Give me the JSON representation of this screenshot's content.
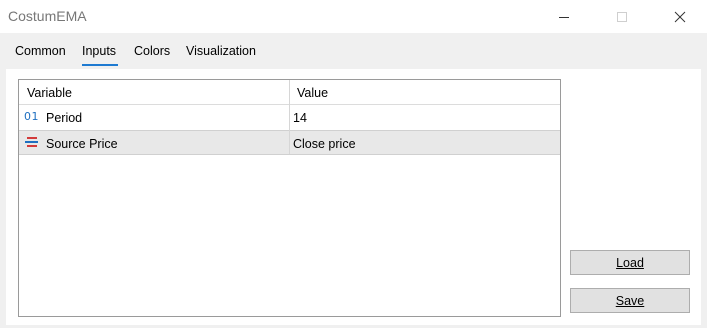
{
  "window": {
    "title": "CostumEMA",
    "controls": {
      "minimize_icon": "minimize-icon",
      "maximize_icon": "maximize-icon",
      "close_icon": "close-icon"
    }
  },
  "tabs": [
    {
      "label": "Common",
      "active": false
    },
    {
      "label": "Inputs",
      "active": true
    },
    {
      "label": "Colors",
      "active": false
    },
    {
      "label": "Visualization",
      "active": false
    }
  ],
  "accent_color": "#1e7ad1",
  "grid": {
    "columns": [
      "Variable",
      "Value"
    ],
    "rows": [
      {
        "icon": "integer-icon",
        "icon_text": "01",
        "variable": "Period",
        "value": "14",
        "selected": false
      },
      {
        "icon": "enum-list-icon",
        "variable": "Source Price",
        "value": "Close price",
        "selected": true
      }
    ]
  },
  "buttons": {
    "load_label": "Load",
    "save_label": "Save"
  }
}
